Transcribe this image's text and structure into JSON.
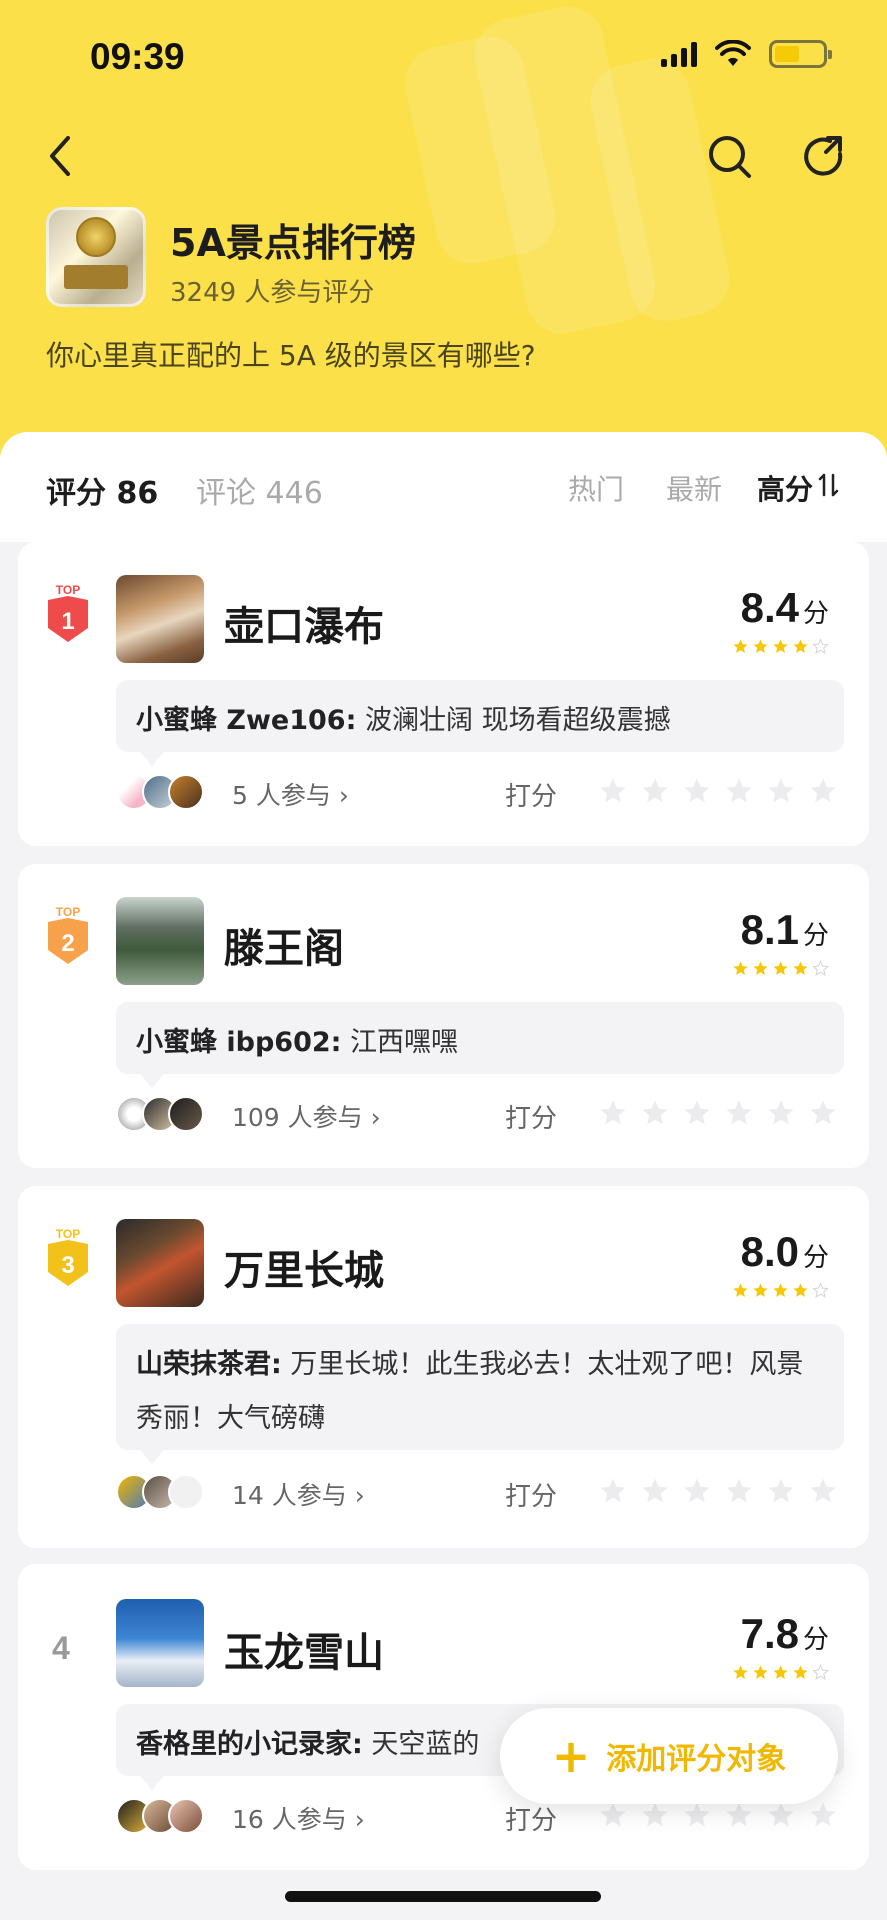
{
  "status_bar": {
    "time": "09:39"
  },
  "header": {
    "title": "5A景点排行榜",
    "participants": "3249 人参与评分",
    "question": "你心里真正配的上 5A 级的景区有哪些?"
  },
  "tabs": {
    "score": "评分 86",
    "comments": "评论 446"
  },
  "sort": {
    "hot": "热门",
    "newest": "最新",
    "high_score": "高分"
  },
  "items": [
    {
      "rank_label": "TOP",
      "rank": "1",
      "name": "壶口瀑布",
      "score": "8.4",
      "unit": "分",
      "stars": 4,
      "comment_author": "小蜜蜂 Zwe106:",
      "comment_text": "波澜壮阔 现场看超级震撼",
      "participants": "5 人参与",
      "rate_label": "打分"
    },
    {
      "rank_label": "TOP",
      "rank": "2",
      "name": "滕王阁",
      "score": "8.1",
      "unit": "分",
      "stars": 4,
      "comment_author": "小蜜蜂 ibp602:",
      "comment_text": "江西嘿嘿",
      "participants": "109 人参与",
      "rate_label": "打分"
    },
    {
      "rank_label": "TOP",
      "rank": "3",
      "name": "万里长城",
      "score": "8.0",
      "unit": "分",
      "stars": 4,
      "comment_author": "山荣抹茶君:",
      "comment_text": "万里长城！此生我必去！太壮观了吧！风景秀丽！大气磅礴",
      "participants": "14 人参与",
      "rate_label": "打分"
    },
    {
      "rank_label": "",
      "rank": "4",
      "name": "玉龙雪山",
      "score": "7.8",
      "unit": "分",
      "stars": 4,
      "comment_author": "香格里的小记录家:",
      "comment_text": "天空蓝的",
      "participants": "16 人参与",
      "rate_label": "打分"
    }
  ],
  "fab": {
    "label": "添加评分对象"
  },
  "colors": {
    "header_yellow": "#fbe04a",
    "star_yellow": "#f7c700",
    "top1_red": "#ef4b4b",
    "top2_orange": "#f7a24a",
    "top3_gold": "#f3c21a",
    "fab_text": "#f0b800"
  },
  "icons": [
    "back-icon",
    "search-icon",
    "share-icon",
    "sort-toggle-icon",
    "star-icon",
    "chevron-right-icon",
    "plus-icon"
  ]
}
